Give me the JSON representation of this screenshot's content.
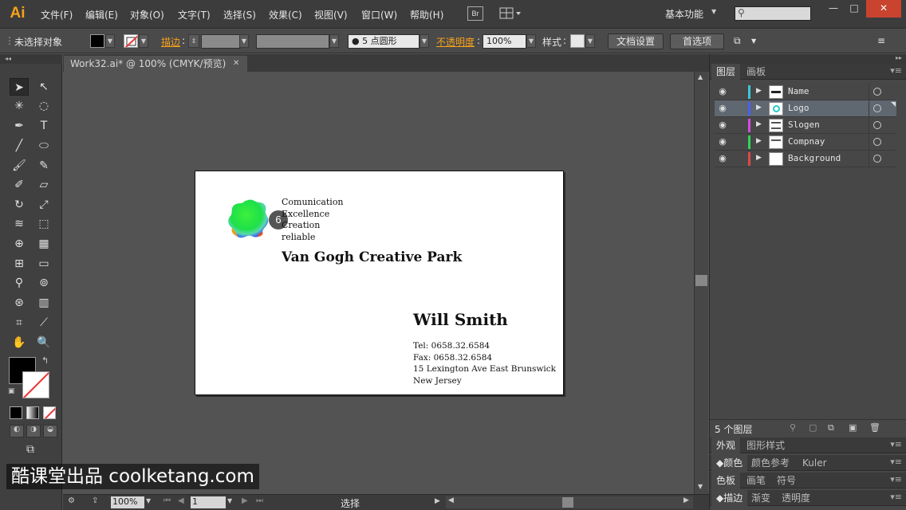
{
  "app": {
    "logo": "Ai",
    "workspace": "基本功能"
  },
  "menu": [
    "文件(F)",
    "编辑(E)",
    "对象(O)",
    "文字(T)",
    "选择(S)",
    "效果(C)",
    "视图(V)",
    "窗口(W)",
    "帮助(H)"
  ],
  "menubar_extra": {
    "bridge": "Br"
  },
  "window_controls": {
    "minimize": "—",
    "maximize": "□",
    "close": "✕"
  },
  "controlbar": {
    "selection_status": "未选择对象",
    "stroke_label": "描边",
    "brush_value": "5 点圆形",
    "opacity_label": "不透明度",
    "opacity_value": "100%",
    "style_label": "样式",
    "doc_setup_button": "文档设置",
    "preferences_button": "首选项"
  },
  "document": {
    "tab_title": "Work32.ai* @ 100% (CMYK/预览)",
    "zoom": "100%",
    "artboard_num": "1",
    "status_text": "选择"
  },
  "card": {
    "logo_badge": "6",
    "taglines": [
      "Comunication",
      "Excellence",
      "Creation",
      "reliable"
    ],
    "company": "Van Gogh Creative Park",
    "person": "Will Smith",
    "contact": [
      "Tel: 0658.32.6584",
      "Fax: 0658.32.6584",
      "15 Lexington Ave East Brunswick",
      "New Jersey"
    ]
  },
  "layers_panel": {
    "tabs": [
      "图层",
      "画板"
    ],
    "layers": [
      {
        "name": "Name",
        "color": "#3cc8d8",
        "selected": false
      },
      {
        "name": "Logo",
        "color": "#4b5ff0",
        "selected": true
      },
      {
        "name": "Slogen",
        "color": "#d44be0",
        "selected": false
      },
      {
        "name": "Compnay",
        "color": "#2ed65a",
        "selected": false
      },
      {
        "name": "Background",
        "color": "#e04848",
        "selected": false
      }
    ],
    "count_label": "5 个图层"
  },
  "collapsed_panels": [
    {
      "tabs": [
        "外观",
        "图形样式"
      ]
    },
    {
      "tabs": [
        "颜色",
        "颜色参考",
        "Kuler"
      ]
    },
    {
      "tabs": [
        "色板",
        "画笔",
        "符号"
      ]
    },
    {
      "tabs": [
        "描边",
        "渐变",
        "透明度"
      ]
    }
  ],
  "watermark": "酷课堂出品 coolketang.com"
}
